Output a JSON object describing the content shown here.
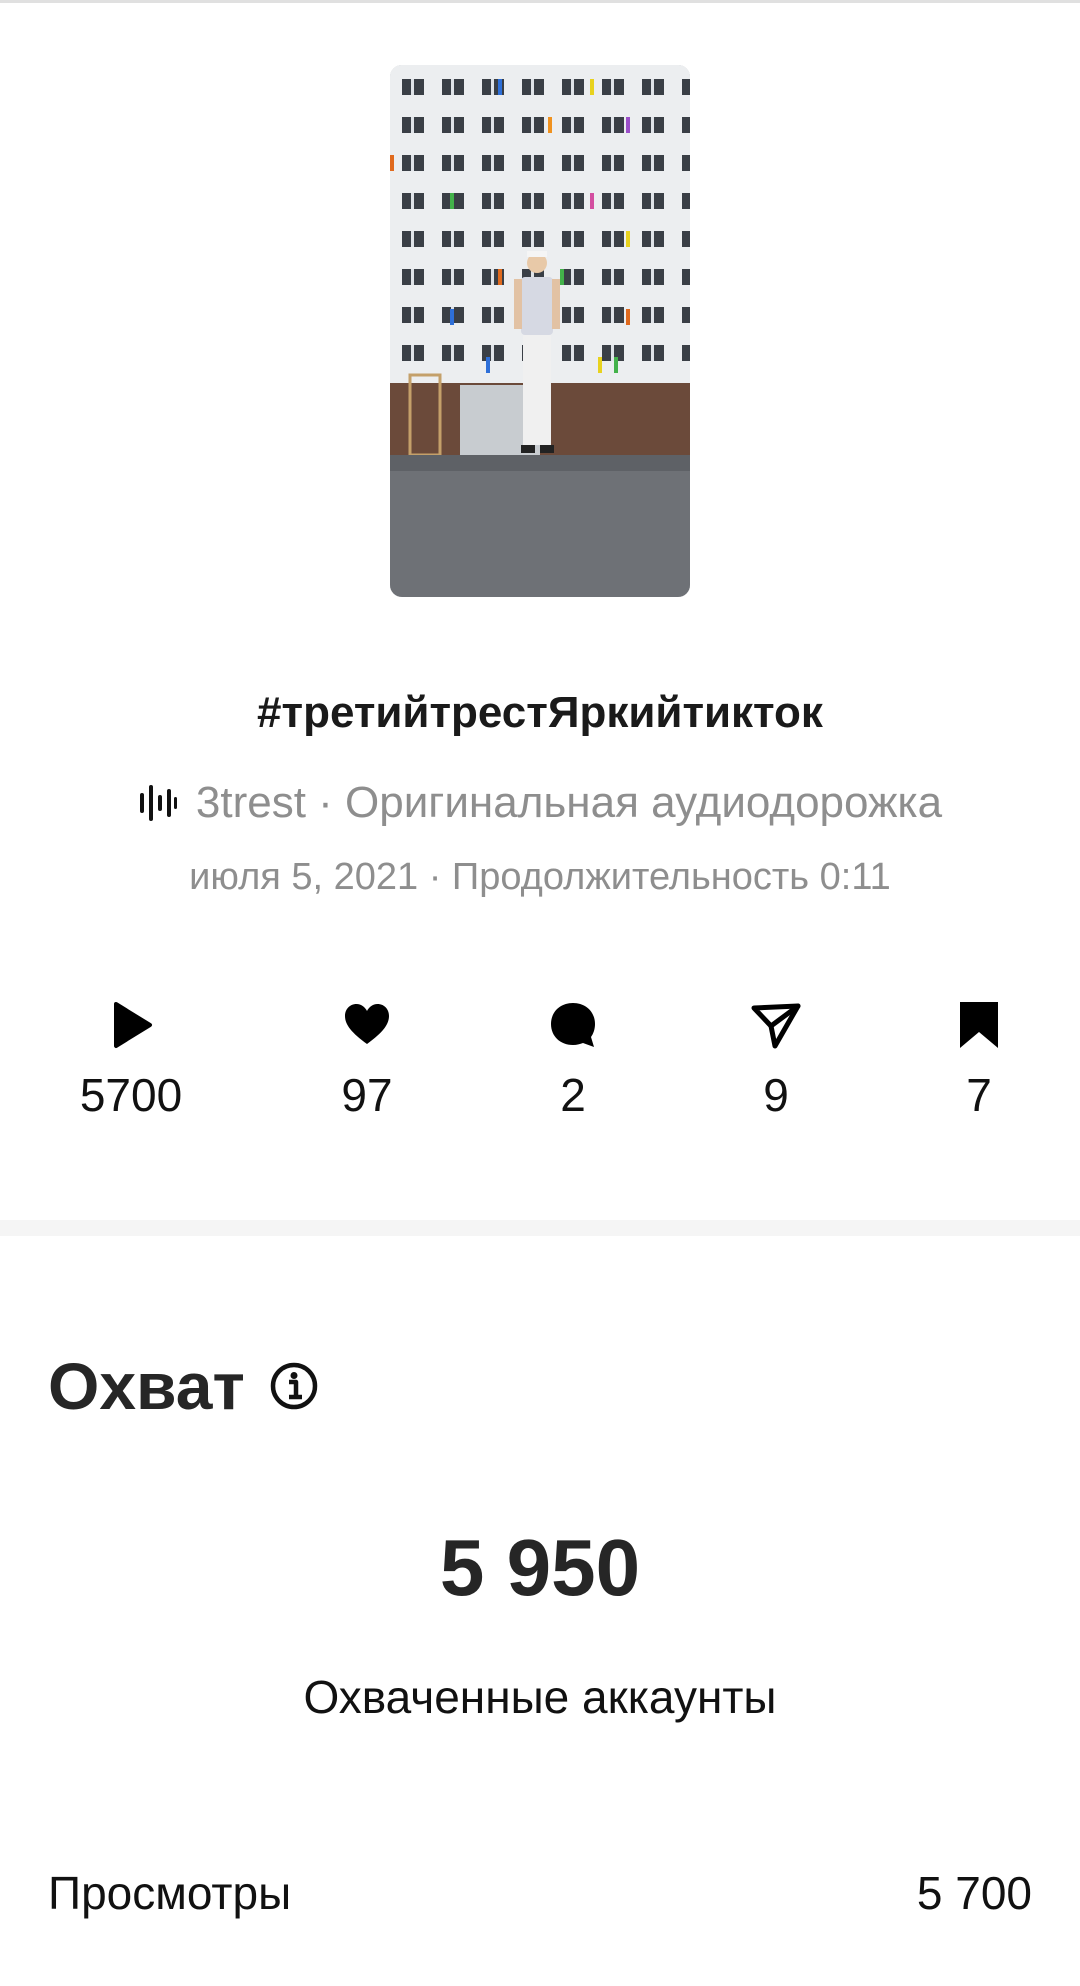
{
  "post": {
    "caption": "#третийтрестЯркийтикток",
    "audio_text": "3trest · Оригинальная аудиодорожка",
    "meta_text": "июля 5, 2021 · Продолжительность 0:11"
  },
  "stats": {
    "plays": "5700",
    "likes": "97",
    "comments": "2",
    "shares": "9",
    "saves": "7"
  },
  "icons": {
    "audio": "audio-waveform-icon",
    "plays": "play-icon",
    "likes": "heart-icon",
    "comments": "comment-icon",
    "shares": "send-icon",
    "saves": "bookmark-icon",
    "info": "info-icon"
  },
  "reach": {
    "title": "Охват",
    "value": "5 950",
    "label": "Охваченные аккаунты",
    "rows": [
      {
        "label": "Просмотры",
        "value": "5 700"
      }
    ]
  }
}
